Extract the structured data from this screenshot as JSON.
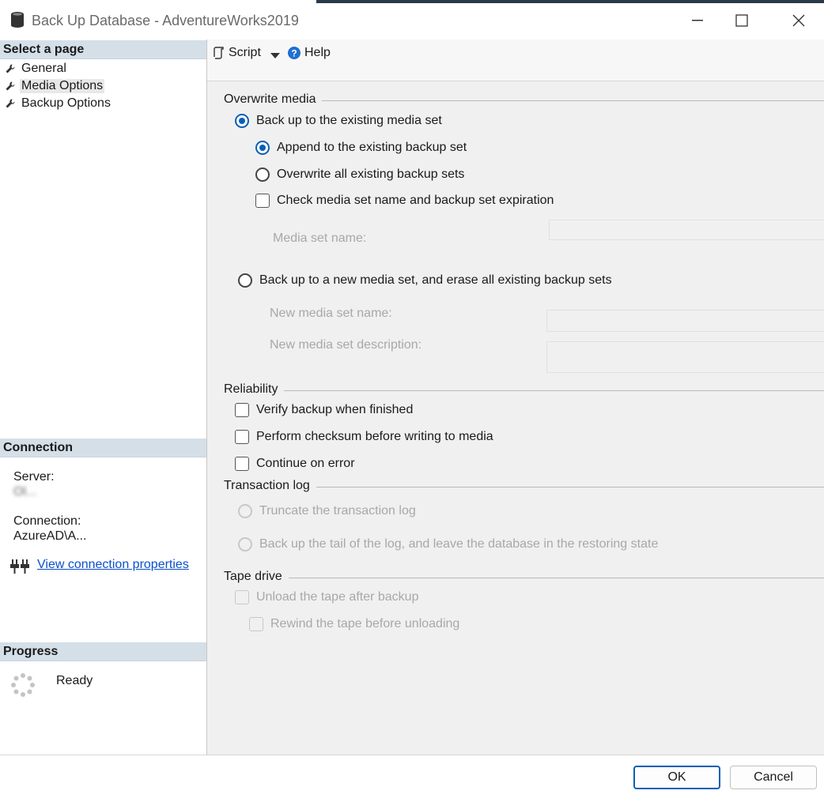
{
  "window": {
    "title": "Back Up Database - AdventureWorks2019",
    "minimize_icon": "minimize-icon",
    "maximize_icon": "maximize-icon",
    "close_icon": "close-icon"
  },
  "sidebar": {
    "select_page_header": "Select a page",
    "pages": [
      {
        "label": "General",
        "icon": "wrench-icon"
      },
      {
        "label": "Media Options",
        "icon": "wrench-icon",
        "selected": true
      },
      {
        "label": "Backup Options",
        "icon": "wrench-icon"
      }
    ],
    "connection": {
      "header": "Connection",
      "server_label": "Server:",
      "server_value": "Ol...",
      "connection_label": "Connection:",
      "connection_value": "AzureAD\\A...",
      "properties_link": "View connection properties"
    },
    "progress": {
      "header": "Progress",
      "status": "Ready"
    }
  },
  "toolbar": {
    "script_label": "Script",
    "help_label": "Help"
  },
  "overwrite_media": {
    "group_label": "Overwrite media",
    "existing_media_set": "Back up to the existing media set",
    "append_existing": "Append to the existing backup set",
    "overwrite_all": "Overwrite all existing backup sets",
    "check_media_set": "Check media set name and backup set expiration",
    "media_set_name_label": "Media set name:",
    "new_media_set": "Back up to a new media set, and erase all existing backup sets",
    "new_media_set_name_label": "New media set name:",
    "new_media_set_desc_label": "New media set description:"
  },
  "reliability": {
    "group_label": "Reliability",
    "verify_backup": "Verify backup when finished",
    "perform_checksum": "Perform checksum before writing to media",
    "continue_on_error": "Continue on error"
  },
  "transaction_log": {
    "group_label": "Transaction log",
    "truncate_log": "Truncate the transaction log",
    "backup_tail": "Back up the tail of the log, and leave the database in the restoring state"
  },
  "tape_drive": {
    "group_label": "Tape drive",
    "unload_tape": "Unload the tape after backup",
    "rewind_tape": "Rewind the tape before unloading"
  },
  "footer": {
    "ok_label": "OK",
    "cancel_label": "Cancel"
  },
  "colors": {
    "accent": "#0a5fb4",
    "header_band": "#d4dfe8",
    "link": "#0b4fcc"
  }
}
